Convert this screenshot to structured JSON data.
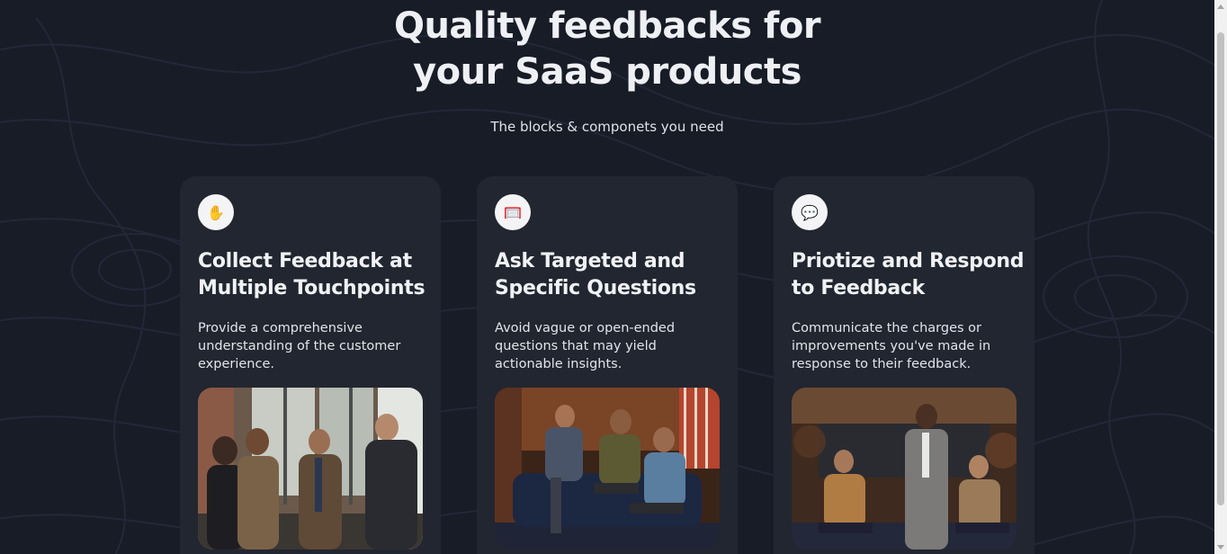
{
  "hero": {
    "title_line1": "Quality feedbacks for",
    "title_line2": "your SaaS products",
    "subtitle": "The blocks & componets you need"
  },
  "cards": [
    {
      "icon": "raised-hand-icon",
      "icon_glyph": "✋",
      "title": "Collect Feedback at Multiple Touchpoints",
      "description": "Provide a comprehensive understanding of the customer experience."
    },
    {
      "icon": "goal-net-icon",
      "icon_glyph": "🥅",
      "title": "Ask Targeted and Specific Questions",
      "description": "Avoid vague or open-ended questions that may yield actionable insights."
    },
    {
      "icon": "speech-bubble-icon",
      "icon_glyph": "💬",
      "title": "Priotize and Respond to Feedback",
      "description": "Communicate the charges or improvements you've made in response to their feedback."
    }
  ],
  "colors": {
    "background": "#181c27",
    "card": "#222630",
    "text": "#eef0f4"
  }
}
